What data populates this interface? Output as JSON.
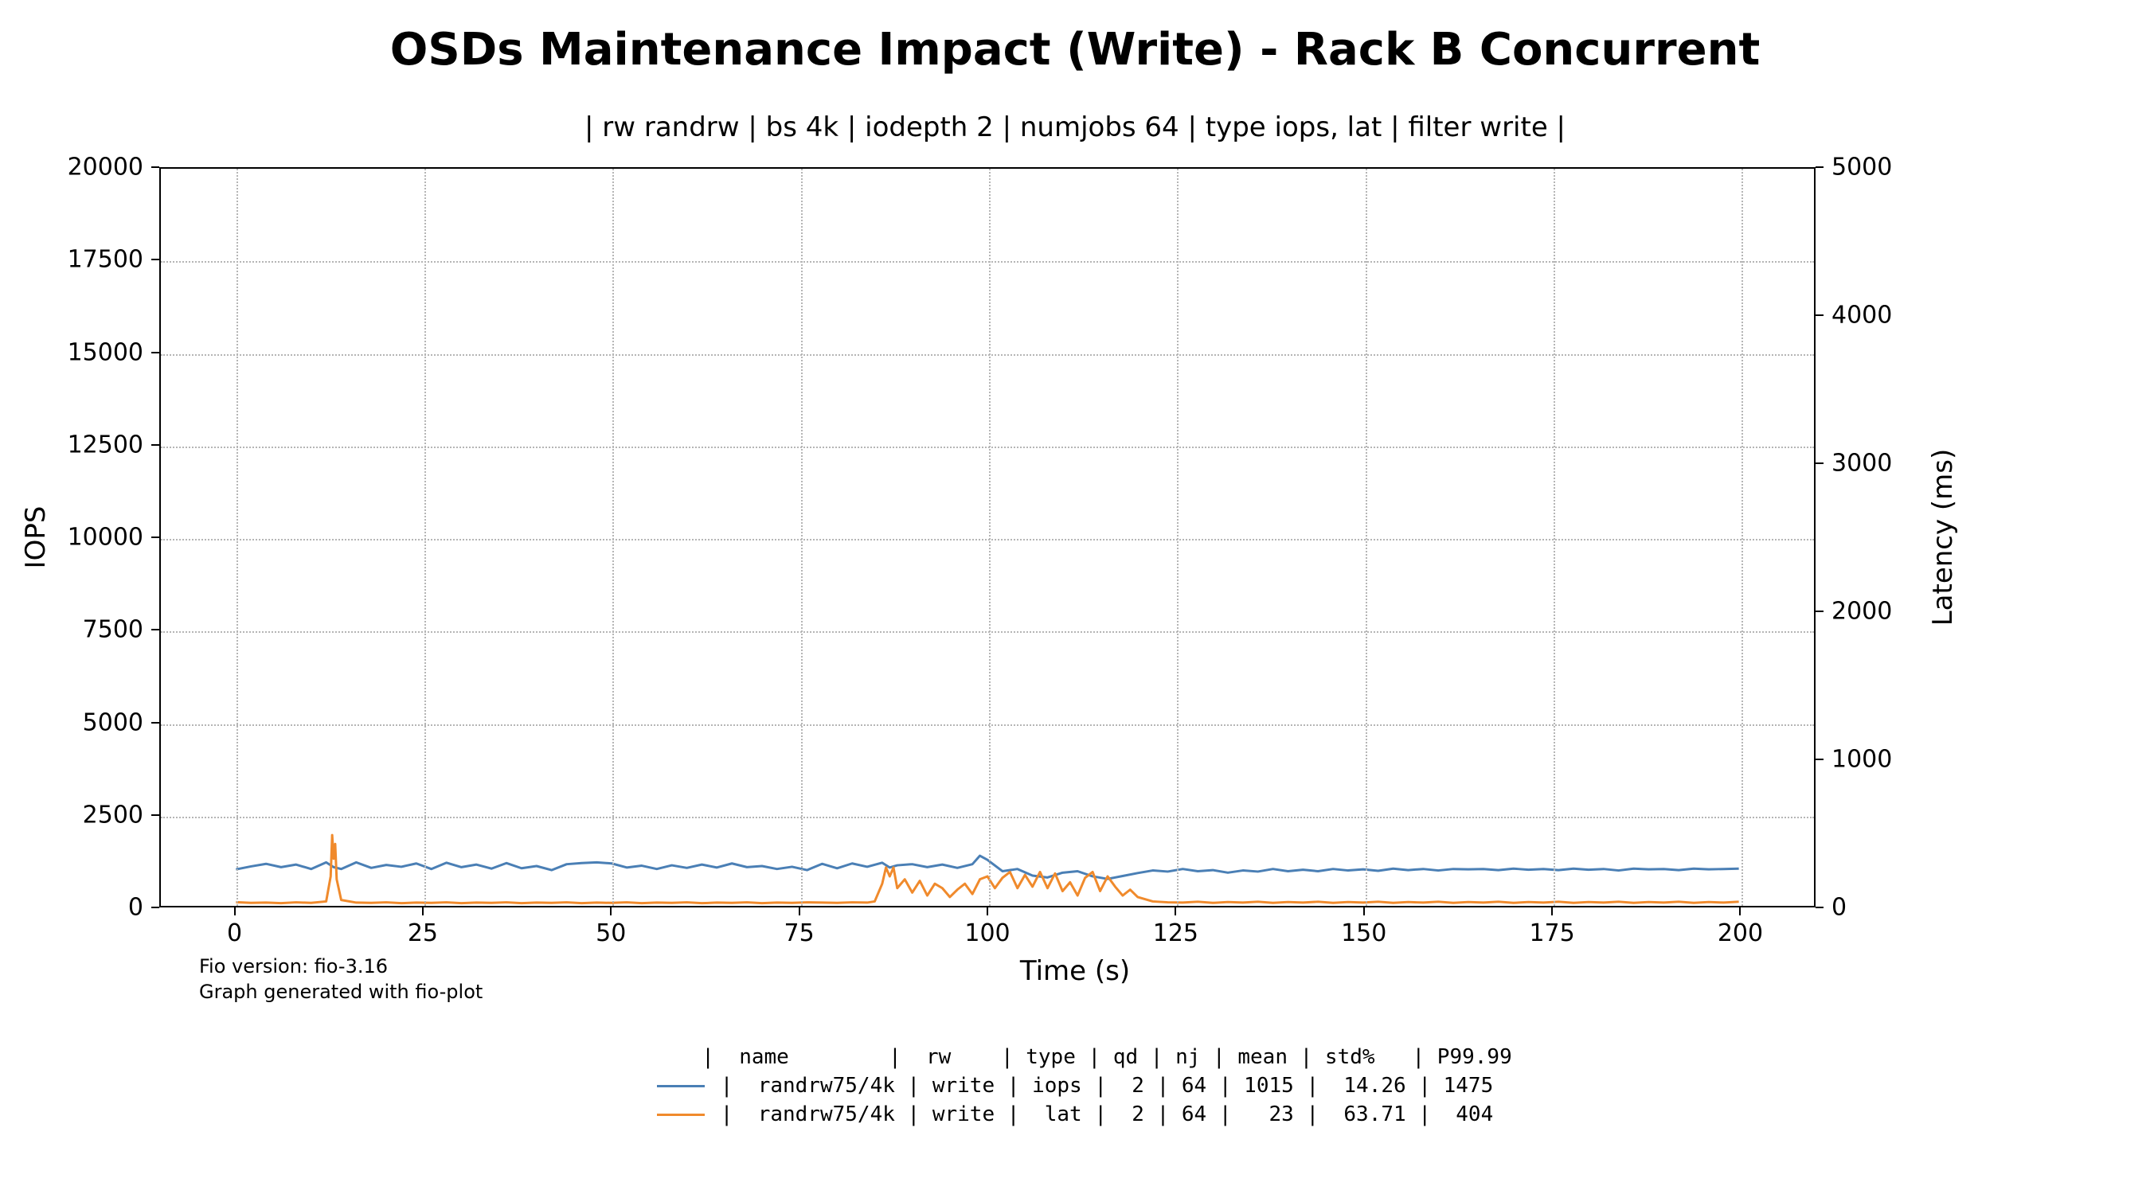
{
  "title": "OSDs Maintenance Impact (Write) - Rack B Concurrent",
  "subtitle": "| rw randrw | bs 4k | iodepth 2 | numjobs 64 | type iops, lat | filter write |",
  "xlabel": "Time (s)",
  "ylabel_left": "IOPS",
  "ylabel_right": "Latency (ms)",
  "footnote1": "Fio version: fio-3.16",
  "footnote2": "Graph generated with fio-plot",
  "colors": {
    "iops": "#4a7fb5",
    "lat": "#f08a2c"
  },
  "legend_header": "|  name        |  rw    | type | qd | nj | mean | std%   | P99.99",
  "legend_rows": [
    {
      "swatch": "iops",
      "text": "|  randrw75/4k | write | iops |  2 | 64 | 1015 |  14.26 | 1475"
    },
    {
      "swatch": "lat",
      "text": "|  randrw75/4k | write |  lat |  2 | 64 |   23 |  63.71 |  404"
    }
  ],
  "chart_data": {
    "type": "line",
    "xlabel": "Time (s)",
    "xlim": [
      -10,
      210
    ],
    "title": "OSDs Maintenance Impact (Write) - Rack B Concurrent",
    "x_ticks": [
      0,
      25,
      50,
      75,
      100,
      125,
      150,
      175,
      200
    ],
    "axes": [
      {
        "side": "left",
        "label": "IOPS",
        "ylim": [
          0,
          20000
        ],
        "ticks": [
          0,
          2500,
          5000,
          7500,
          10000,
          12500,
          15000,
          17500,
          20000
        ]
      },
      {
        "side": "right",
        "label": "Latency (ms)",
        "ylim": [
          0,
          5000
        ],
        "ticks": [
          0,
          1000,
          2000,
          3000,
          4000,
          5000
        ]
      }
    ],
    "series": [
      {
        "name": "randrw75/4k write iops",
        "axis": "left",
        "color": "#4a7fb5",
        "stats": {
          "qd": 2,
          "nj": 64,
          "mean": 1015,
          "std_pct": 14.26,
          "p9999": 1475
        },
        "x": [
          0,
          2,
          4,
          6,
          8,
          10,
          12,
          13,
          14,
          16,
          18,
          20,
          22,
          24,
          26,
          28,
          30,
          32,
          34,
          36,
          38,
          40,
          42,
          44,
          46,
          48,
          50,
          52,
          54,
          56,
          58,
          60,
          62,
          64,
          66,
          68,
          70,
          72,
          74,
          76,
          78,
          80,
          82,
          84,
          86,
          87,
          88,
          90,
          92,
          94,
          96,
          98,
          99,
          100,
          102,
          104,
          106,
          108,
          110,
          112,
          114,
          116,
          118,
          120,
          122,
          124,
          126,
          128,
          130,
          132,
          134,
          136,
          138,
          140,
          142,
          144,
          146,
          148,
          150,
          152,
          154,
          156,
          158,
          160,
          162,
          164,
          166,
          168,
          170,
          172,
          174,
          176,
          178,
          180,
          182,
          184,
          186,
          188,
          190,
          192,
          194,
          196,
          198,
          200
        ],
        "values": [
          990,
          1070,
          1140,
          1050,
          1120,
          1000,
          1180,
          1050,
          1000,
          1180,
          1030,
          1110,
          1060,
          1150,
          1000,
          1170,
          1050,
          1120,
          1010,
          1160,
          1020,
          1080,
          970,
          1130,
          1160,
          1180,
          1150,
          1040,
          1090,
          1000,
          1100,
          1030,
          1120,
          1040,
          1150,
          1050,
          1080,
          1000,
          1060,
          970,
          1140,
          1020,
          1150,
          1060,
          1170,
          1040,
          1100,
          1130,
          1050,
          1120,
          1030,
          1130,
          1360,
          1250,
          940,
          1000,
          820,
          770,
          900,
          940,
          800,
          730,
          810,
          890,
          960,
          930,
          1000,
          940,
          970,
          900,
          960,
          930,
          1000,
          940,
          980,
          940,
          1000,
          960,
          990,
          950,
          1010,
          970,
          1000,
          960,
          1000,
          990,
          1000,
          970,
          1010,
          980,
          1000,
          970,
          1010,
          980,
          1000,
          960,
          1010,
          990,
          1000,
          970,
          1010,
          990,
          1000,
          1010
        ]
      },
      {
        "name": "randrw75/4k write lat",
        "axis": "right",
        "color": "#f08a2c",
        "stats": {
          "qd": 2,
          "nj": 64,
          "mean": 23,
          "std_pct": 63.71,
          "p9999": 404
        },
        "x": [
          0,
          2,
          4,
          6,
          8,
          10,
          12,
          12.6,
          12.8,
          13,
          13.2,
          13.4,
          14,
          16,
          18,
          20,
          22,
          24,
          26,
          28,
          30,
          32,
          34,
          36,
          38,
          40,
          42,
          44,
          46,
          48,
          50,
          52,
          54,
          56,
          58,
          60,
          62,
          64,
          66,
          68,
          70,
          72,
          74,
          76,
          78,
          80,
          82,
          84,
          85,
          86,
          86.5,
          87,
          87.5,
          88,
          89,
          90,
          91,
          92,
          93,
          94,
          95,
          96,
          97,
          98,
          99,
          100,
          101,
          102,
          103,
          104,
          105,
          106,
          107,
          108,
          109,
          110,
          111,
          112,
          113,
          114,
          115,
          116,
          117,
          118,
          119,
          120,
          122,
          124,
          126,
          128,
          130,
          132,
          134,
          136,
          138,
          140,
          142,
          144,
          146,
          148,
          150,
          152,
          154,
          156,
          158,
          160,
          162,
          164,
          166,
          168,
          170,
          172,
          174,
          176,
          178,
          180,
          182,
          184,
          186,
          188,
          190,
          192,
          194,
          196,
          198,
          200
        ],
        "values": [
          25,
          20,
          22,
          18,
          24,
          20,
          30,
          200,
          480,
          320,
          420,
          180,
          40,
          22,
          20,
          24,
          18,
          22,
          20,
          24,
          18,
          22,
          20,
          24,
          18,
          22,
          20,
          24,
          18,
          22,
          20,
          24,
          18,
          22,
          20,
          24,
          18,
          22,
          20,
          24,
          18,
          22,
          20,
          24,
          22,
          20,
          24,
          22,
          30,
          150,
          260,
          200,
          260,
          120,
          180,
          90,
          170,
          70,
          150,
          120,
          60,
          110,
          150,
          80,
          180,
          200,
          120,
          190,
          230,
          120,
          210,
          130,
          230,
          120,
          220,
          100,
          160,
          70,
          190,
          230,
          100,
          200,
          130,
          70,
          110,
          60,
          30,
          24,
          22,
          28,
          20,
          26,
          22,
          28,
          20,
          26,
          22,
          28,
          20,
          26,
          22,
          28,
          20,
          26,
          22,
          28,
          20,
          26,
          22,
          28,
          20,
          26,
          22,
          28,
          20,
          26,
          22,
          28,
          20,
          26,
          22,
          28,
          20,
          26,
          22,
          28
        ]
      }
    ]
  }
}
